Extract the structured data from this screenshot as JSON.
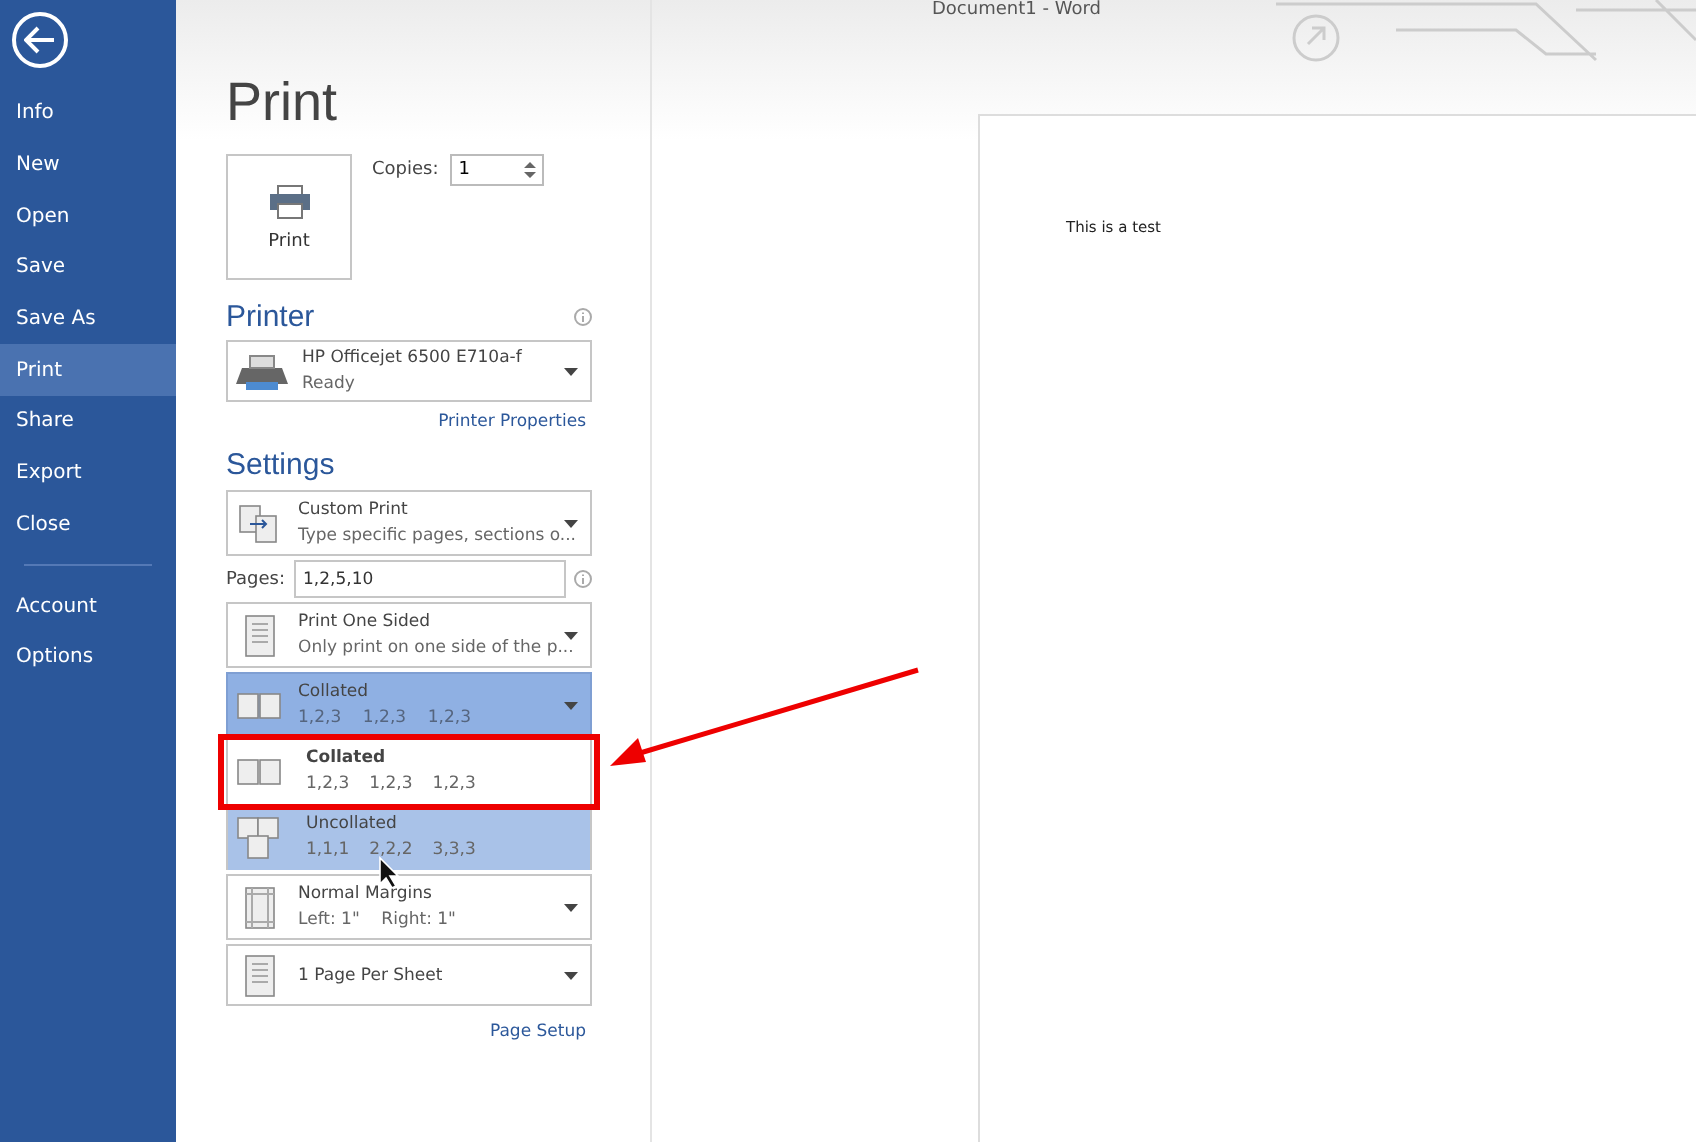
{
  "window": {
    "title": "Document1 - Word"
  },
  "sidebar": {
    "items": [
      {
        "label": "Info",
        "selected": false
      },
      {
        "label": "New",
        "selected": false
      },
      {
        "label": "Open",
        "selected": false
      },
      {
        "label": "Save",
        "selected": false
      },
      {
        "label": "Save As",
        "selected": false
      },
      {
        "label": "Print",
        "selected": true
      },
      {
        "label": "Share",
        "selected": false
      },
      {
        "label": "Export",
        "selected": false
      },
      {
        "label": "Close",
        "selected": false
      }
    ],
    "footer_items": [
      {
        "label": "Account",
        "selected": false
      },
      {
        "label": "Options",
        "selected": false
      }
    ]
  },
  "heading": "Print",
  "print_button": {
    "label": "Print"
  },
  "copies": {
    "label": "Copies:",
    "value": "1"
  },
  "printer": {
    "heading": "Printer",
    "name": "HP Officejet 6500 E710a-f",
    "status": "Ready",
    "link": "Printer Properties"
  },
  "settings": {
    "heading": "Settings",
    "items": [
      {
        "kind": "dropdown",
        "title": "Custom Print",
        "subtitle": "Type specific pages, sections o...",
        "expanded": false
      },
      {
        "kind": "pages",
        "label": "Pages:",
        "value": "1,2,5,10"
      },
      {
        "kind": "dropdown",
        "title": "Print One Sided",
        "subtitle": "Only print on one side of the p...",
        "expanded": false
      },
      {
        "kind": "dropdown",
        "title": "Collated",
        "subtitle": "1,2,3    1,2,3    1,2,3",
        "expanded": true,
        "options": [
          {
            "title": "Collated",
            "values": [
              "1,2,3",
              "1,2,3",
              "1,2,3"
            ],
            "selected": true,
            "hovered": false
          },
          {
            "title": "Uncollated",
            "values": [
              "1,1,1",
              "2,2,2",
              "3,3,3"
            ],
            "selected": false,
            "hovered": true
          }
        ]
      },
      {
        "kind": "dropdown",
        "title": "Normal Margins",
        "subtitle": "Left: 1\"    Right: 1\"",
        "expanded": false
      },
      {
        "kind": "dropdown",
        "title": "1 Page Per Sheet",
        "expanded": false
      }
    ],
    "link": "Page Setup"
  },
  "preview": {
    "text": "This is a test"
  }
}
